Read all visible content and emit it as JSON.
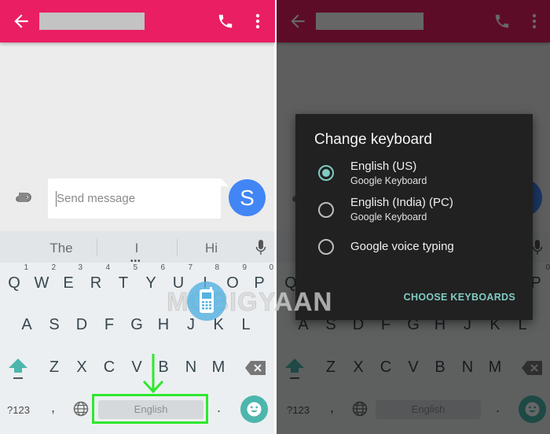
{
  "colors": {
    "appbar": "#e91e63",
    "accent_teal": "#80cbc4",
    "send_blue": "#4285f4",
    "annotation_green": "#2ee82e",
    "emoji_button": "#4db6ac"
  },
  "left_screen": {
    "appbar": {
      "back_icon": "arrow-left",
      "title": "",
      "call_icon": "phone",
      "menu_icon": "more-vertical"
    },
    "compose": {
      "attach_icon": "paperclip",
      "placeholder": "Send message",
      "send_avatar_letter": "S"
    },
    "keyboard": {
      "suggestions": [
        "The",
        "I",
        "Hi"
      ],
      "more_suggestions": "•••",
      "mic_icon": "microphone",
      "row1": [
        {
          "key": "Q",
          "hint": "1"
        },
        {
          "key": "W",
          "hint": "2"
        },
        {
          "key": "E",
          "hint": "3"
        },
        {
          "key": "R",
          "hint": "4"
        },
        {
          "key": "T",
          "hint": "5"
        },
        {
          "key": "Y",
          "hint": "6"
        },
        {
          "key": "U",
          "hint": "7"
        },
        {
          "key": "I",
          "hint": "8"
        },
        {
          "key": "O",
          "hint": "9"
        },
        {
          "key": "P",
          "hint": "0"
        }
      ],
      "row2": [
        "A",
        "S",
        "D",
        "F",
        "G",
        "H",
        "J",
        "K",
        "L"
      ],
      "row3": [
        "Z",
        "X",
        "C",
        "V",
        "B",
        "N",
        "M"
      ],
      "symbols_key": "?123",
      "comma_key": ",",
      "language_icon": "globe",
      "spacebar_label": "English",
      "period_key": ".",
      "emoji_icon": "smiley"
    },
    "annotation": {
      "arrow_icon": "arrow-down",
      "highlight": "spacebar"
    }
  },
  "right_screen": {
    "dialog": {
      "title": "Change keyboard",
      "options": [
        {
          "name": "English (US)",
          "subtitle": "Google Keyboard",
          "selected": true
        },
        {
          "name": "English (India) (PC)",
          "subtitle": "Google Keyboard",
          "selected": false
        },
        {
          "name": "Google voice typing",
          "subtitle": "",
          "selected": false
        }
      ],
      "action": "CHOOSE KEYBOARDS"
    }
  },
  "watermark": {
    "text": "MOBIGYAAN"
  }
}
